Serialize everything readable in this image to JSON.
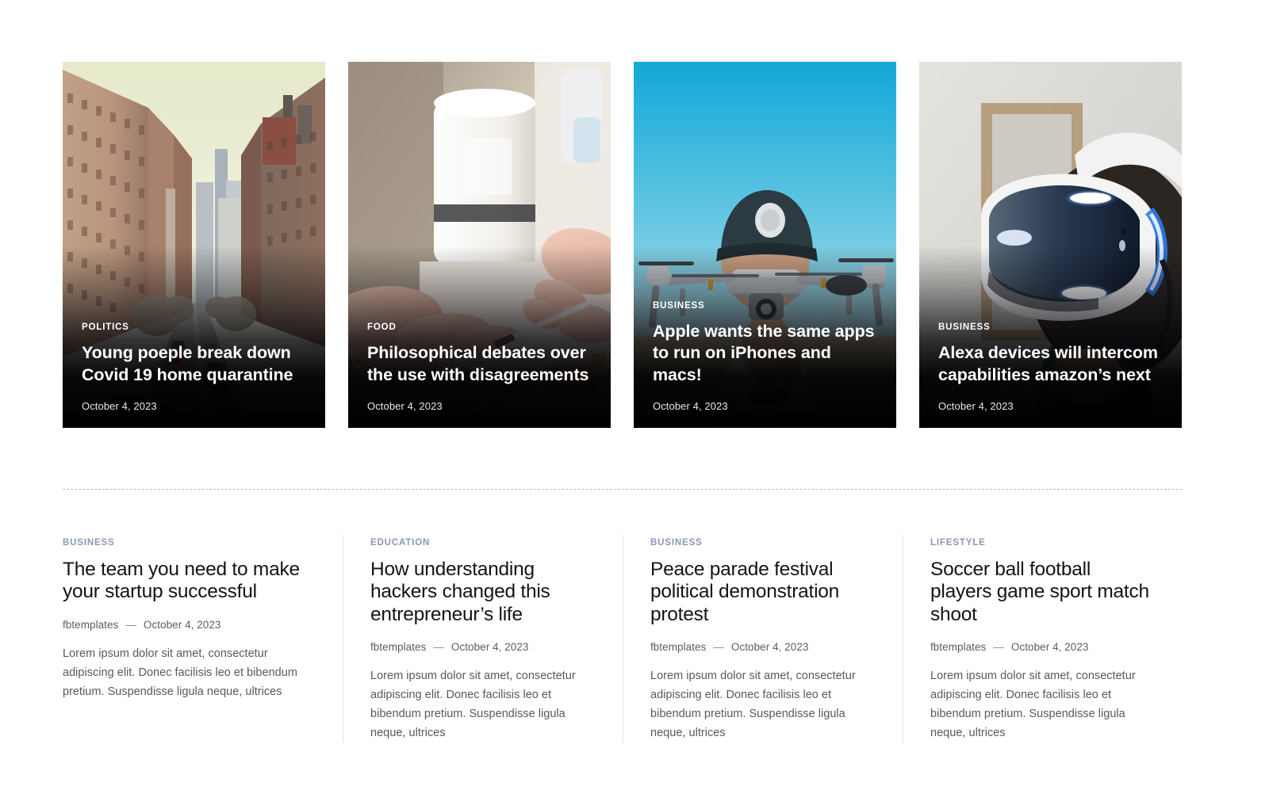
{
  "hero": {
    "cards": [
      {
        "category": "POLITICS",
        "title": "Young poeple break down Covid 19 home quarantine",
        "date": "October 4, 2023",
        "image": "city-street-photo"
      },
      {
        "category": "FOOD",
        "title": "Philosophical debates over the use with disagreements",
        "date": "October 4, 2023",
        "image": "manicure-nail-salon-photo"
      },
      {
        "category": "BUSINESS",
        "title": "Apple wants the same apps to run on iPhones and macs!",
        "date": "October 4, 2023",
        "image": "drone-operator-photo"
      },
      {
        "category": "BUSINESS",
        "title": "Alexa devices will intercom capabilities amazon’s next",
        "date": "October 4, 2023",
        "image": "vr-headset-photo"
      }
    ]
  },
  "articles": [
    {
      "category": "BUSINESS",
      "title": "The team you need to make your startup successful",
      "author": "fbtemplates",
      "separator": "—",
      "date": "October 4, 2023",
      "excerpt": "Lorem ipsum dolor sit amet, consectetur adipiscing elit. Donec facilisis leo et bibendum pretium. Suspendisse ligula neque, ultrices"
    },
    {
      "category": "EDUCATION",
      "title": "How understanding hackers changed this entrepreneur’s life",
      "author": "fbtemplates",
      "separator": "—",
      "date": "October 4, 2023",
      "excerpt": "Lorem ipsum dolor sit amet, consectetur adipiscing elit. Donec facilisis leo et bibendum pretium. Suspendisse ligula neque, ultrices"
    },
    {
      "category": "BUSINESS",
      "title": "Peace parade festival political demonstration protest",
      "author": "fbtemplates",
      "separator": "—",
      "date": "October 4, 2023",
      "excerpt": "Lorem ipsum dolor sit amet, consectetur adipiscing elit. Donec facilisis leo et bibendum pretium. Suspendisse ligula neque, ultrices"
    },
    {
      "category": "LIFESTYLE",
      "title": "Soccer ball football players game sport match shoot",
      "author": "fbtemplates",
      "separator": "—",
      "date": "October 4, 2023",
      "excerpt": "Lorem ipsum dolor sit amet, consectetur adipiscing elit. Donec facilisis leo et bibendum pretium. Suspendisse ligula neque, ultrices"
    }
  ],
  "colors": {
    "background": "#ffffff",
    "hero_category": "#ffffff",
    "hero_title": "#ffffff",
    "article_category": "#8b96b8",
    "article_title": "#141414",
    "article_body": "#595959",
    "divider": "#e4e4e4",
    "separator_dashed": "#b9b9b9"
  }
}
